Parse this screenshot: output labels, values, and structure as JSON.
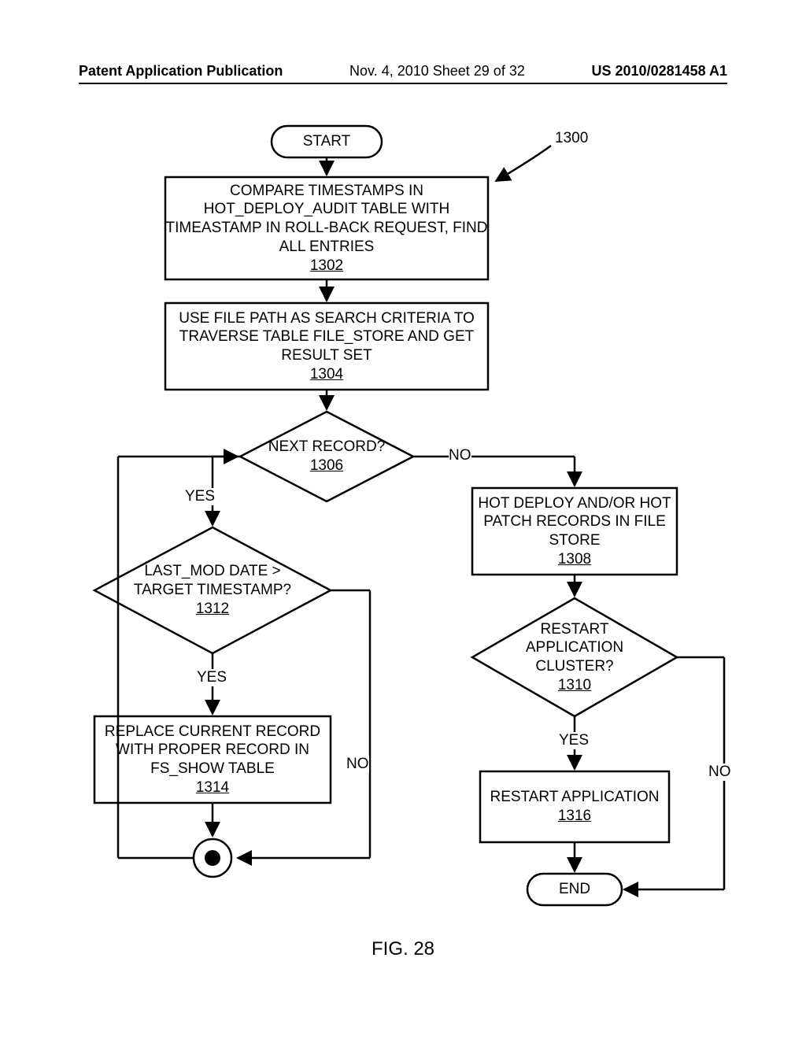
{
  "header": {
    "left": "Patent Application Publication",
    "mid": "Nov. 4, 2010  Sheet 29 of 32",
    "right": "US 2010/0281458 A1"
  },
  "figure_label": "FIG. 28",
  "ref_number": "1300",
  "nodes": {
    "start": "START",
    "n1302_text": "COMPARE TIMESTAMPS IN HOT_DEPLOY_AUDIT TABLE WITH TIMEASTAMP IN ROLL-BACK REQUEST, FIND ALL ENTRIES",
    "n1302_ref": "1302",
    "n1304_text": "USE FILE PATH AS SEARCH CRITERIA TO TRAVERSE TABLE FILE_STORE AND GET RESULT SET",
    "n1304_ref": "1304",
    "n1306_text": "NEXT RECORD?",
    "n1306_ref": "1306",
    "n1308_text": "HOT DEPLOY AND/OR HOT PATCH RECORDS IN FILE STORE",
    "n1308_ref": "1308",
    "n1310_text": "RESTART APPLICATION CLUSTER?",
    "n1310_ref": "1310",
    "n1312_text": "LAST_MOD DATE > TARGET TIMESTAMP?",
    "n1312_ref": "1312",
    "n1314_text": "REPLACE CURRENT RECORD WITH PROPER RECORD IN FS_SHOW TABLE",
    "n1314_ref": "1314",
    "n1316_text": "RESTART APPLICATION",
    "n1316_ref": "1316",
    "end": "END"
  },
  "labels": {
    "yes": "YES",
    "no": "NO"
  }
}
